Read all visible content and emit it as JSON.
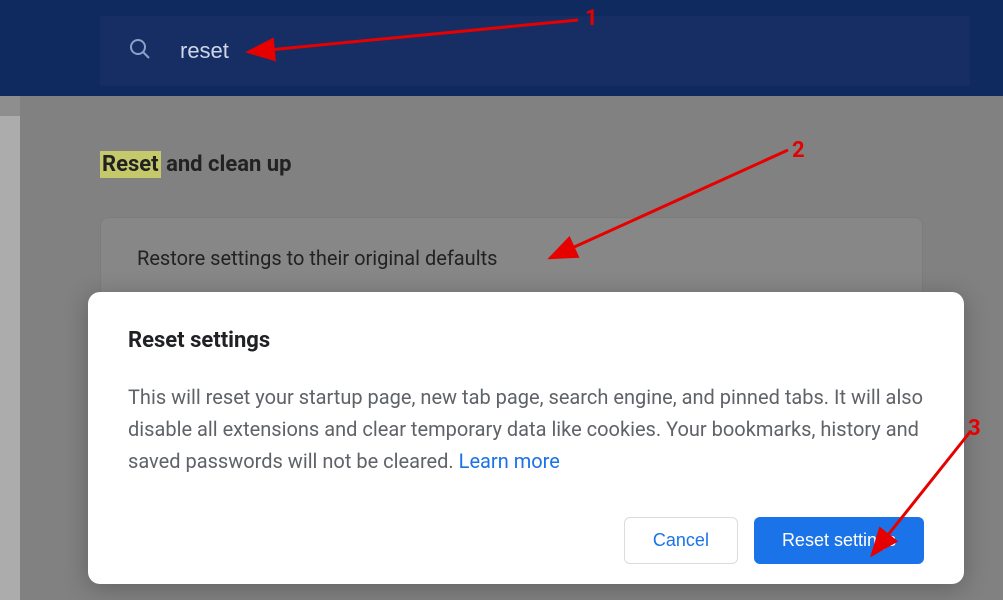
{
  "search": {
    "value": "reset"
  },
  "section": {
    "title_highlighted": "Reset",
    "title_rest": " and clean up",
    "item": "Restore settings to their original defaults"
  },
  "dialog": {
    "title": "Reset settings",
    "body": "This will reset your startup page, new tab page, search engine, and pinned tabs. It will also disable all extensions and clear temporary data like cookies. Your bookmarks, history and saved passwords will not be cleared. ",
    "learn_more": "Learn more",
    "cancel": "Cancel",
    "confirm": "Reset settings"
  },
  "annotations": {
    "n1": "1",
    "n2": "2",
    "n3": "3"
  }
}
